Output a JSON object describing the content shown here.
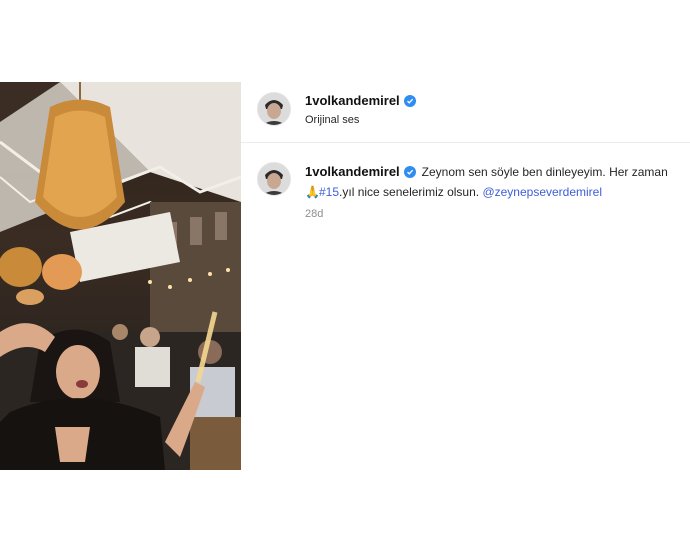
{
  "post": {
    "username": "1volkandemirel",
    "audio": "Orijinal ses"
  },
  "comment": {
    "username": "1volkandemirel",
    "text_line1": "Zeynom sen söyle ben dinleyeyim. Her zaman",
    "emoji": "🙏",
    "hashtag": "#15",
    "text_line2": ".yıl nice senelerimiz olsun.",
    "mention": "@zeynepseverdemirel",
    "age": "28d"
  },
  "colors": {
    "verified": "#2f8cf0",
    "link": "#3f5ed6"
  }
}
